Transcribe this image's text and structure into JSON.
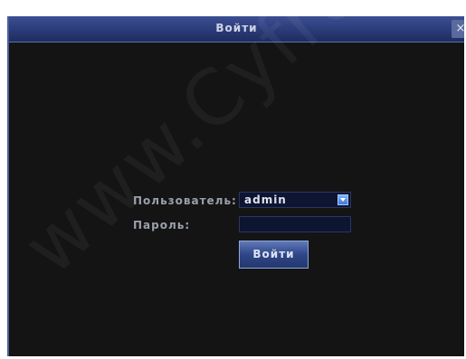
{
  "window": {
    "title": "Войти",
    "close_symbol": "×"
  },
  "watermark": "www.Cyfron.ru",
  "form": {
    "user_label": "Пользователь:",
    "user_value": "admin",
    "password_label": "Пароль:",
    "password_value": "",
    "submit_label": "Войти"
  },
  "icons": {
    "close": "close-icon",
    "dropdown": "chevron-down-icon"
  },
  "colors": {
    "titlebar": "#2b3b78",
    "background": "#141414",
    "button": "#2f4688"
  }
}
